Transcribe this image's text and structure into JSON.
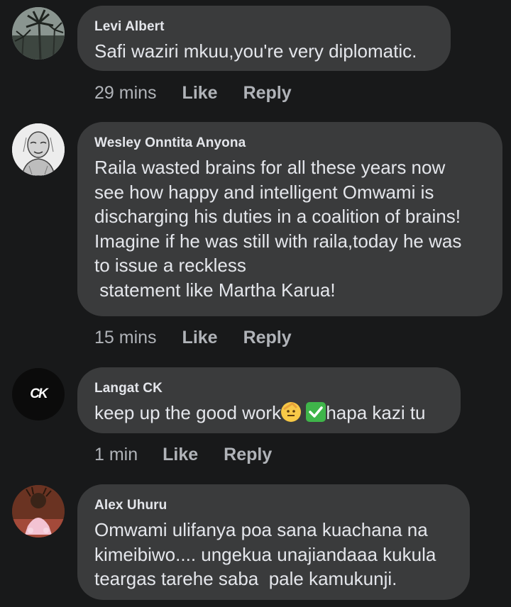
{
  "comments": [
    {
      "author": "Levi Albert",
      "text": "Safi waziri mkuu,you're very diplomatic.",
      "time": "29 mins",
      "like_label": "Like",
      "reply_label": "Reply"
    },
    {
      "author": "Wesley Onntita Anyona",
      "text": "Raila wasted brains for all these years now\nsee how happy and intelligent Omwami is\ndischarging his duties in a coalition of brains!\nImagine if he was still with raila,today he was\nto issue a reckless\n statement like Martha Karua!",
      "time": "15 mins",
      "like_label": "Like",
      "reply_label": "Reply"
    },
    {
      "author": "Langat CK",
      "text_before": "keep up the good work",
      "text_after": "hapa kazi tu",
      "avatar_initials": "CK",
      "time": "1 min",
      "like_label": "Like",
      "reply_label": "Reply"
    },
    {
      "author": "Alex Uhuru",
      "text": "Omwami ulifanya poa sana kuachana na\nkimeibiwo.... ungekua unajiandaaa kukula\nteargas tarehe saba  pale kamukunji.",
      "time": null
    }
  ],
  "colors": {
    "background": "#18191a",
    "bubble": "#3a3b3c",
    "text": "#e4e6eb",
    "meta": "#b0b3b8"
  },
  "icons": [
    "saluting-face-emoji",
    "check-mark-button-emoji"
  ]
}
